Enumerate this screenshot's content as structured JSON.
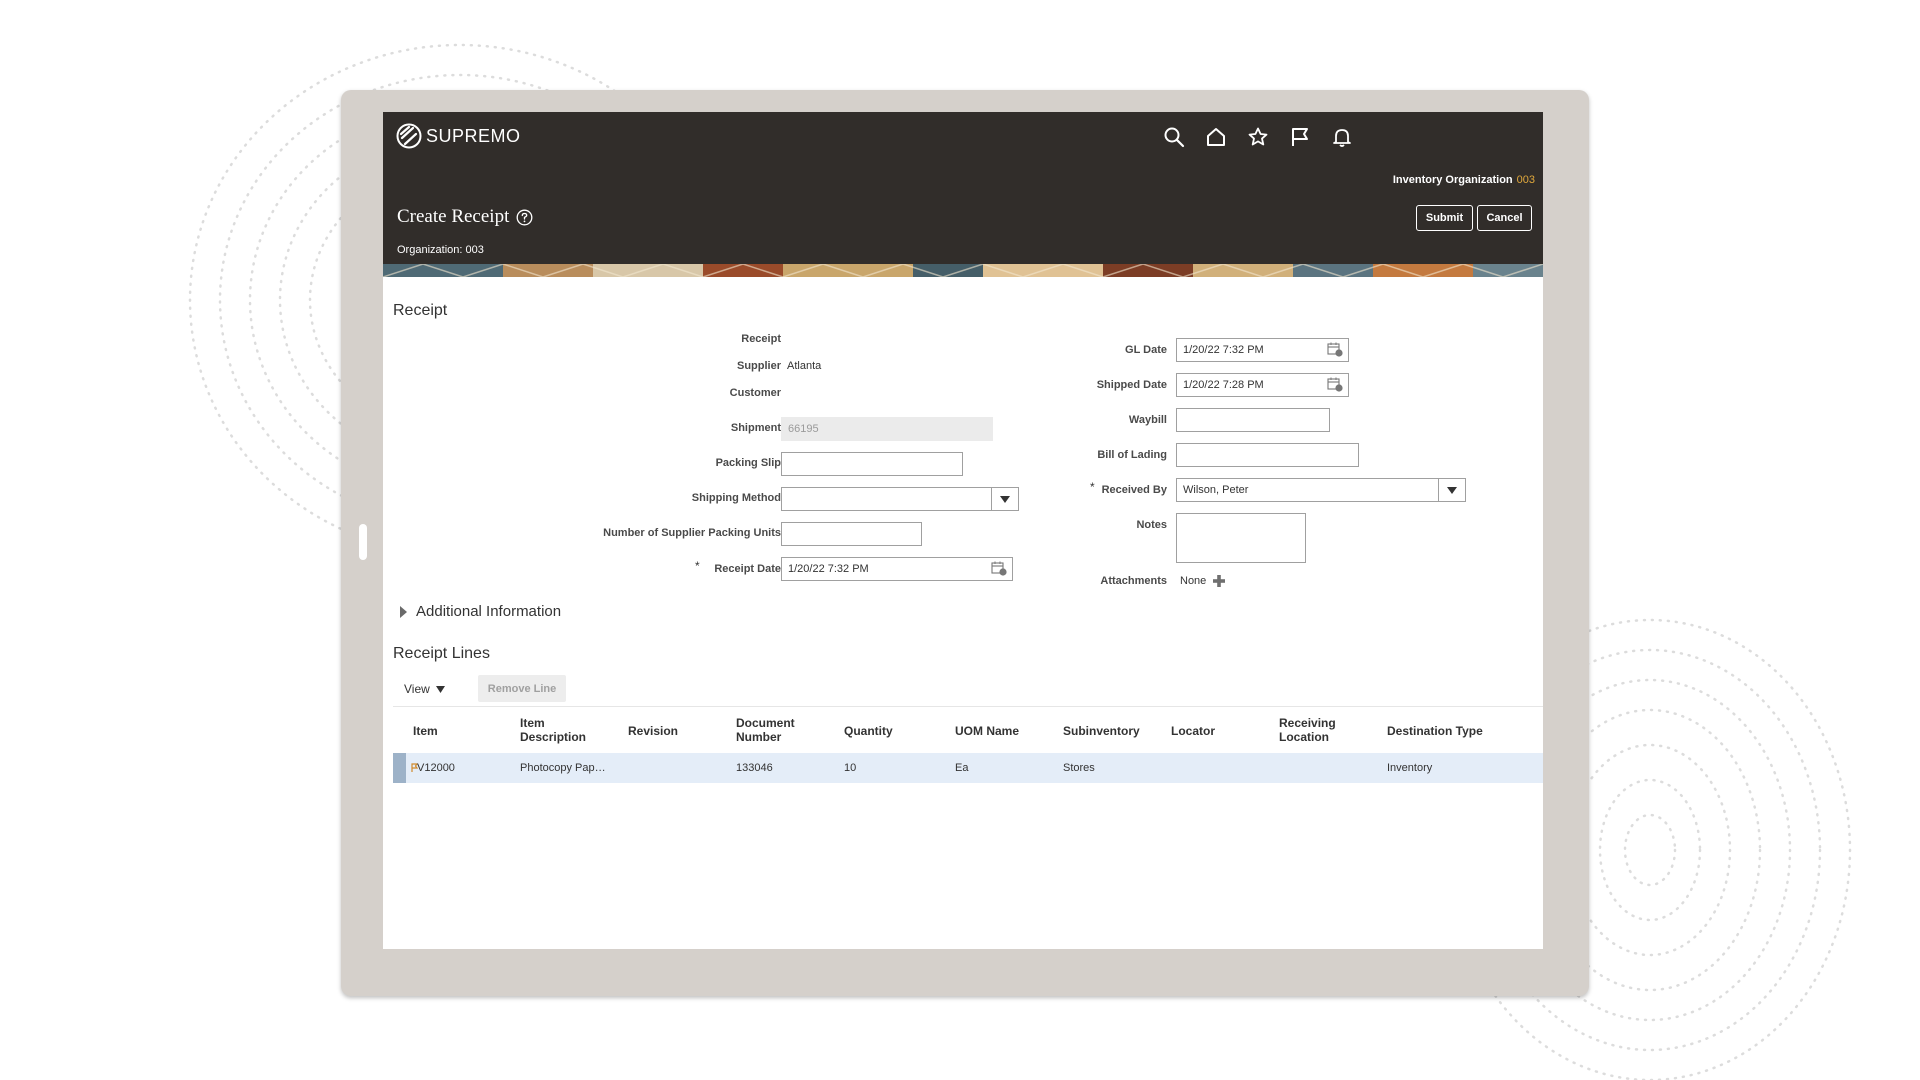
{
  "app": {
    "brand": "SUPREMO",
    "inventory_org_label": "Inventory Organization",
    "inventory_org_value": "003",
    "page_title": "Create Receipt",
    "organization": "Organization: 003",
    "submit_label": "Submit",
    "cancel_label": "Cancel",
    "nav_icons": [
      "search-icon",
      "home-icon",
      "star-icon",
      "flag-icon",
      "bell-icon"
    ]
  },
  "receipt": {
    "section_title": "Receipt",
    "receipt_label": "Receipt",
    "supplier_label": "Supplier",
    "supplier_value": "Atlanta",
    "customer_label": "Customer",
    "shipment_label": "Shipment",
    "shipment_value": "66195",
    "packing_slip_label": "Packing Slip",
    "packing_slip_value": "",
    "shipping_method_label": "Shipping Method",
    "shipping_method_value": "",
    "packing_units_label": "Number of Supplier Packing Units",
    "packing_units_value": "",
    "receipt_date_label": "Receipt Date",
    "receipt_date_value": "1/20/22 7:32 PM",
    "gl_date_label": "GL Date",
    "gl_date_value": "1/20/22 7:32 PM",
    "shipped_date_label": "Shipped Date",
    "shipped_date_value": "1/20/22 7:28 PM",
    "waybill_label": "Waybill",
    "waybill_value": "",
    "bill_of_lading_label": "Bill of Lading",
    "bill_of_lading_value": "",
    "received_by_label": "Received By",
    "received_by_value": "Wilson, Peter",
    "notes_label": "Notes",
    "notes_value": "",
    "attachments_label": "Attachments",
    "attachments_value": "None",
    "required_mark": "*",
    "additional_info_label": "Additional Information"
  },
  "lines": {
    "section_title": "Receipt Lines",
    "view_label": "View",
    "remove_line_label": "Remove Line",
    "columns": [
      {
        "l1": "Item",
        "l2": ""
      },
      {
        "l1": "Item",
        "l2": "Description"
      },
      {
        "l1": "Revision",
        "l2": ""
      },
      {
        "l1": "Document",
        "l2": "Number"
      },
      {
        "l1": "Quantity",
        "l2": ""
      },
      {
        "l1": "UOM Name",
        "l2": ""
      },
      {
        "l1": "Subinventory",
        "l2": ""
      },
      {
        "l1": "Locator",
        "l2": ""
      },
      {
        "l1": "Receiving",
        "l2": "Location"
      },
      {
        "l1": "Destination Type",
        "l2": ""
      }
    ],
    "rows": [
      [
        "V12000",
        "Photocopy Pap…",
        "",
        "133046",
        "10",
        "Ea",
        "Stores",
        "",
        "",
        "Inventory"
      ]
    ]
  },
  "colors": {
    "header_bg": "#312d2a",
    "accent_gold": "#e0a83c",
    "row_selected": "#e4edf8"
  }
}
